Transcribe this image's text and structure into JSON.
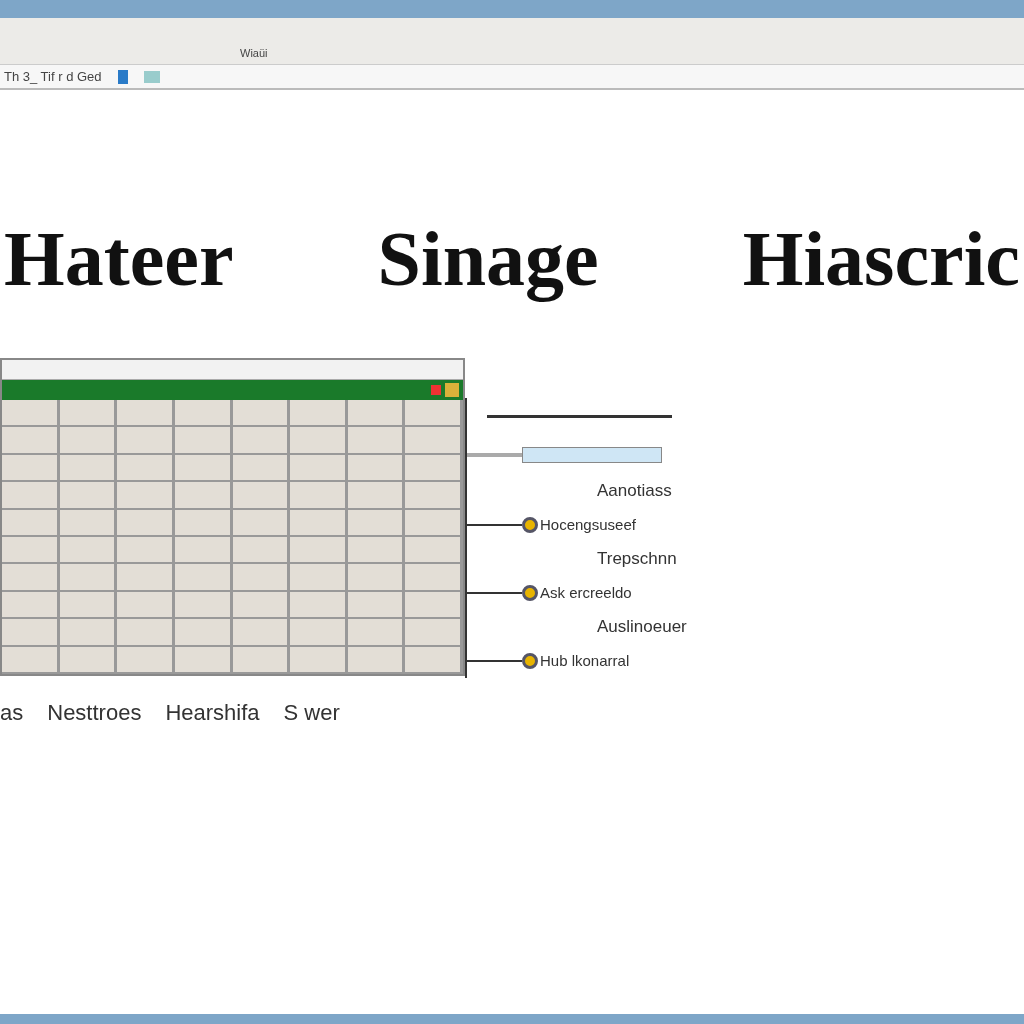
{
  "toolbar": {
    "text": "Th 3_ Tif r d Ged",
    "label": "Wiaüi"
  },
  "title_words": [
    "Hateer",
    "Sinage",
    "Hiascric"
  ],
  "callouts": [
    {
      "kind": "rule"
    },
    {
      "kind": "field"
    },
    {
      "kind": "label",
      "text": "Aanotiass"
    },
    {
      "kind": "dot",
      "text": "Hocengsuseef"
    },
    {
      "kind": "label",
      "text": "Trepschnn"
    },
    {
      "kind": "dot",
      "text": "Ask ercreeldo"
    },
    {
      "kind": "label",
      "text": "Auslinoeuer"
    },
    {
      "kind": "dot",
      "text": "Hub lkonarral"
    }
  ],
  "caption": [
    "as",
    "Nesttroes",
    "Hearshifa",
    "S wer"
  ]
}
